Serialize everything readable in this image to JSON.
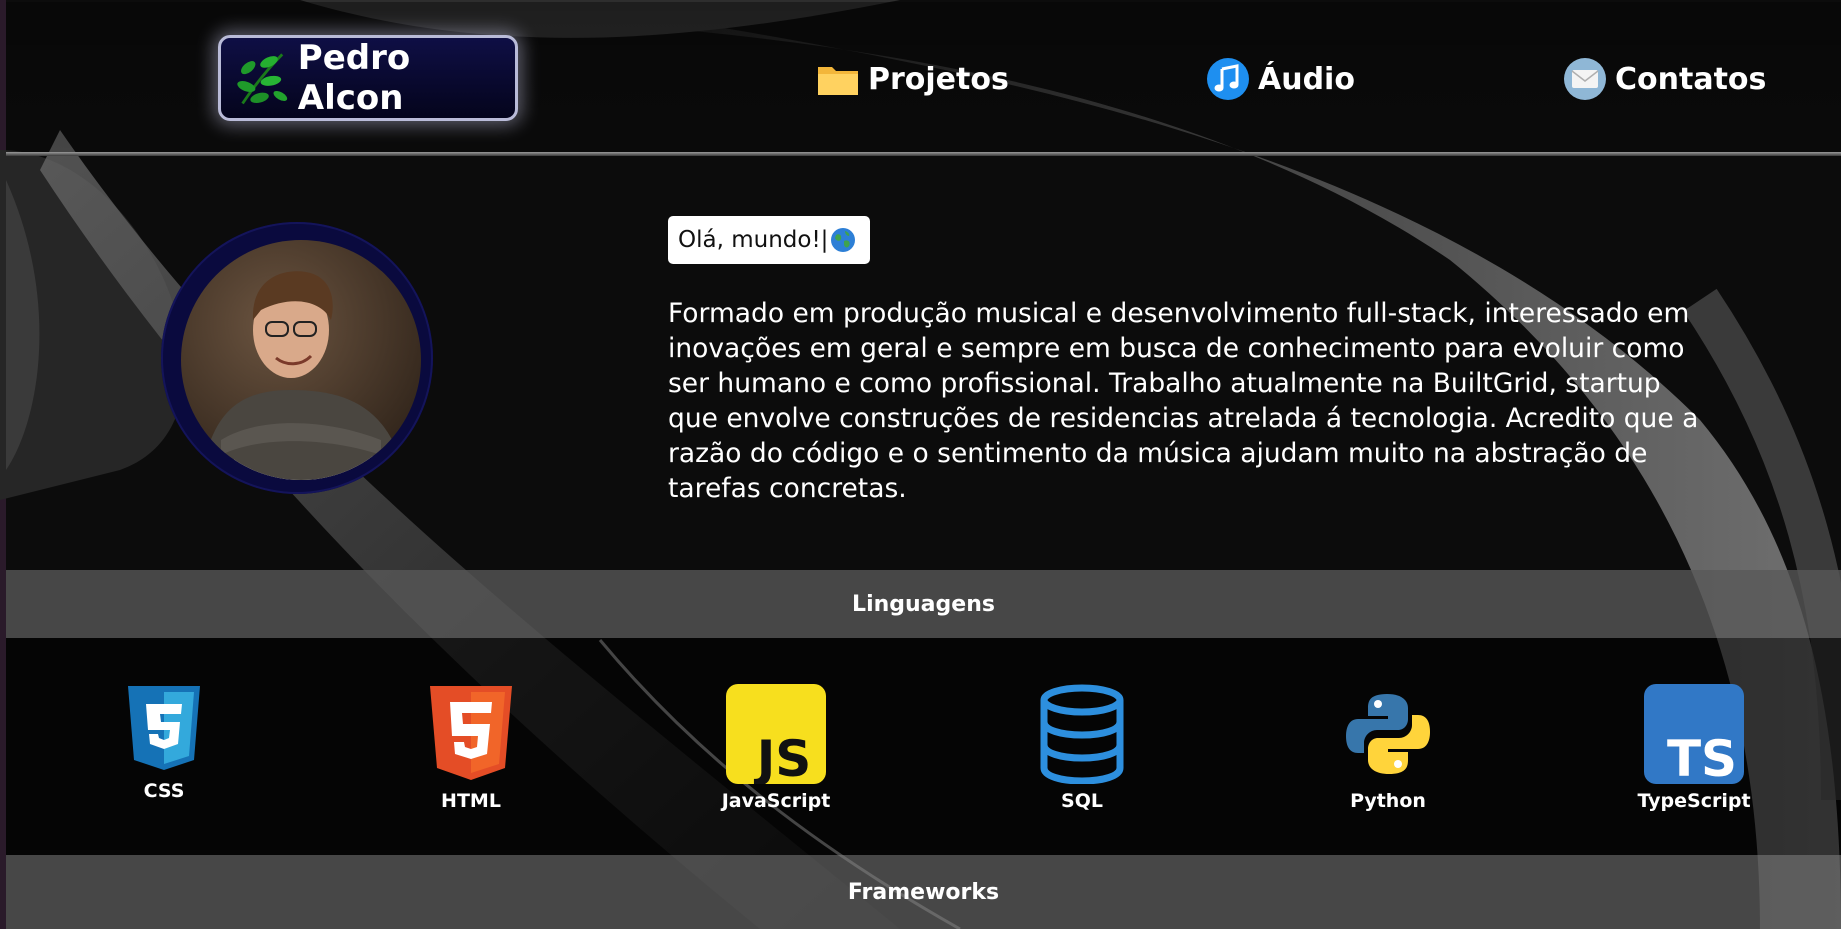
{
  "nav": {
    "brand": "Pedro Alcon",
    "items": [
      {
        "label": "Projetos",
        "icon": "folder-icon"
      },
      {
        "label": "Áudio",
        "icon": "music-note-icon"
      },
      {
        "label": "Contatos",
        "icon": "envelope-icon"
      }
    ]
  },
  "hero": {
    "greeting": "Olá, mundo!|",
    "bio": "Formado em produção musical e desenvolvimento full-stack, interessado em inovações em geral e sempre em busca de conhecimento para evoluir como ser humano e como profissional. Trabalho atualmente na BuiltGrid, startup que envolve construções de residencias atrelada á tecnologia. Acredito que a razão do código e o sentimento da música ajudam muito na abstração de tarefas concretas."
  },
  "sections": {
    "languages_title": "Linguagens",
    "frameworks_title": "Frameworks"
  },
  "languages": [
    {
      "label": "CSS",
      "icon": "css3-icon",
      "color": "#1572b6"
    },
    {
      "label": "HTML",
      "icon": "html5-icon",
      "color": "#e44d26"
    },
    {
      "label": "JavaScript",
      "icon": "javascript-icon",
      "color": "#f7df1e"
    },
    {
      "label": "SQL",
      "icon": "database-icon",
      "color": "#2d8fde"
    },
    {
      "label": "Python",
      "icon": "python-icon",
      "color": "#3776ab"
    },
    {
      "label": "TypeScript",
      "icon": "typescript-icon",
      "color": "#3178c6"
    }
  ],
  "colors": {
    "brand_bg": "#0f0f45",
    "band": "#585858",
    "avatar_ring": "#0a0a3e"
  }
}
